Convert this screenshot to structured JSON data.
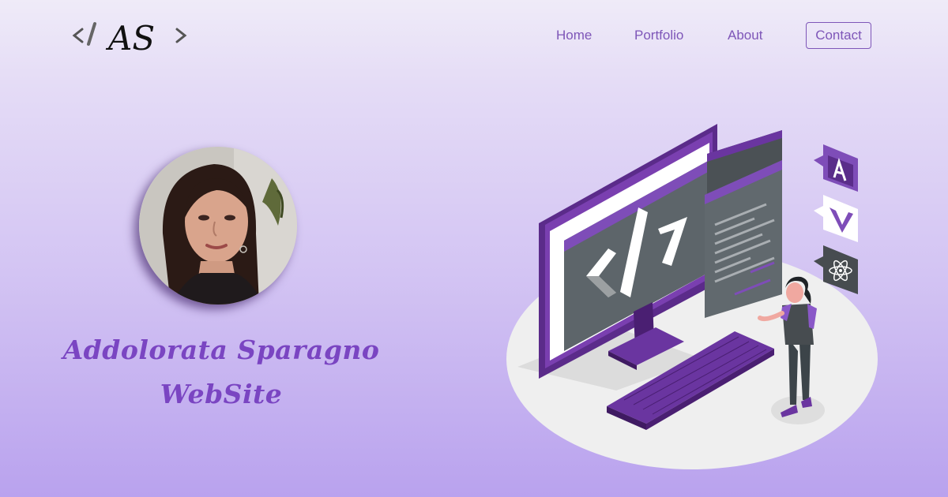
{
  "header": {
    "logo": {
      "monogram": "AS",
      "brackets": [
        "<",
        "/",
        ">"
      ]
    },
    "nav": [
      {
        "id": "home",
        "label": "Home"
      },
      {
        "id": "portfolio",
        "label": "Portfolio"
      },
      {
        "id": "about",
        "label": "About"
      },
      {
        "id": "contact",
        "label": "Contact"
      }
    ]
  },
  "hero": {
    "name_line1": "Addolorata Sparagno",
    "name_line2": "WebSite"
  },
  "illustration": {
    "screen_code_symbol": "</>",
    "framework_icons": [
      "angular-icon",
      "vue-icon",
      "react-icon"
    ]
  },
  "colors": {
    "accent": "#7e56b8",
    "name_text": "#7a45c2",
    "background_top": "#efebf8",
    "background_bottom": "#b9a2ee"
  }
}
